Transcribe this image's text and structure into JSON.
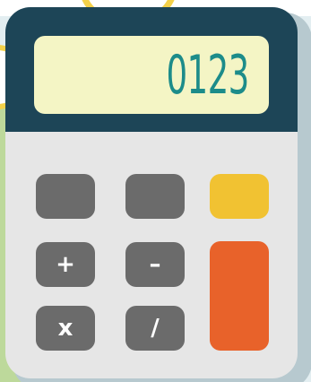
{
  "display": {
    "value": "0123"
  },
  "keys": {
    "plus": "+",
    "minus": "–",
    "multiply": "x",
    "divide": "/"
  },
  "colors": {
    "body": "#e6e6e6",
    "top_panel": "#1d4557",
    "display_bg": "#f4f5c5",
    "display_text": "#1c8c8a",
    "key_gray": "#6b6b6b",
    "key_yellow": "#f1c232",
    "key_orange": "#e8622a"
  }
}
